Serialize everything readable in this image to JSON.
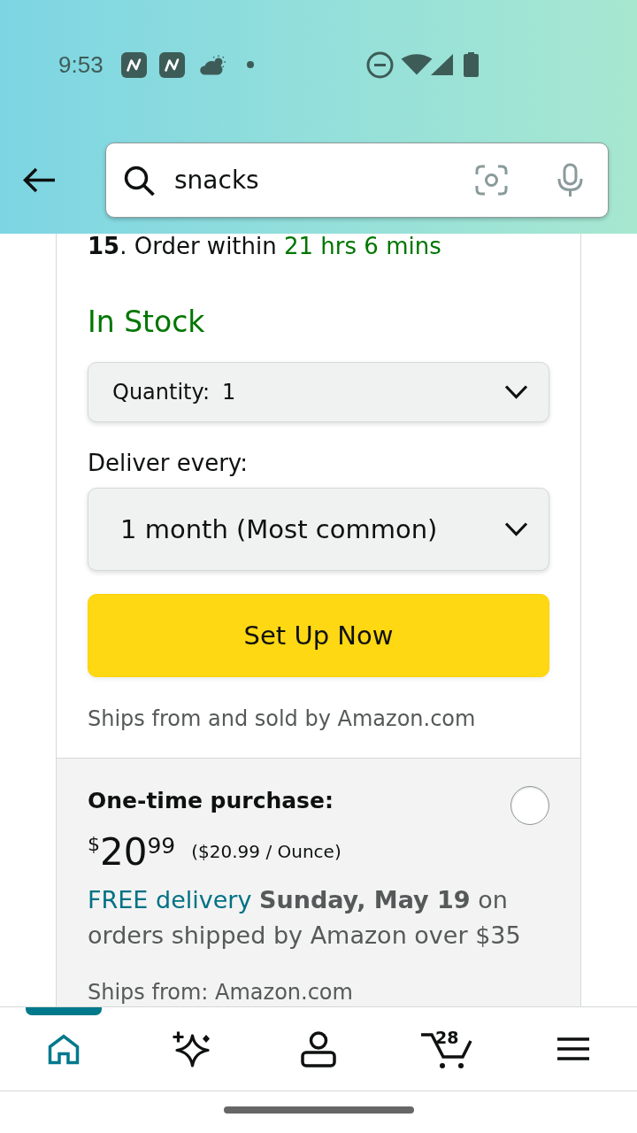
{
  "status_bar": {
    "time": "9:53"
  },
  "search": {
    "value": "snacks"
  },
  "subscription": {
    "delivery_line": {
      "text": "**15**. Order within",
      "countdown": "21 hrs 6 mins"
    },
    "availability": "In Stock",
    "quantity": {
      "label": "Quantity:",
      "value": "1"
    },
    "frequency": {
      "label": "Deliver every:",
      "value": "1 month (Most common)"
    },
    "button": "Set Up Now",
    "seller_note": "Ships from and sold by Amazon.com"
  },
  "one_time_option": {
    "title": "One-time purchase:",
    "selected": false,
    "price": {
      "currency": "$",
      "whole": "20",
      "fraction": "99"
    },
    "unit_price": "($20.99 / Ounce)",
    "delivery": {
      "link": "FREE delivery",
      "text": "**Sunday, May 19** on orders shipped by Amazon over $35"
    },
    "ships_from": "Ships from: Amazon.com"
  },
  "bottom_nav": [
    {
      "kind": "home",
      "selected": true
    },
    {
      "kind": "sparkle",
      "selected": false
    },
    {
      "kind": "account",
      "selected": false
    },
    {
      "kind": "cart",
      "selected": false,
      "badge": "28"
    },
    {
      "kind": "menu",
      "selected": false
    }
  ]
}
